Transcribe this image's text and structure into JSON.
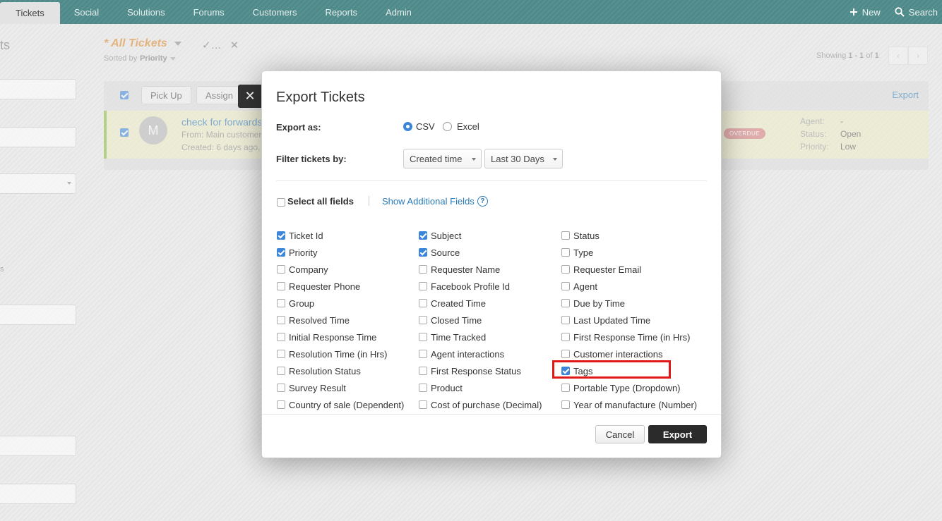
{
  "nav": {
    "tabs": [
      "Tickets",
      "Social",
      "Solutions",
      "Forums",
      "Customers",
      "Reports",
      "Admin"
    ],
    "new_label": "New",
    "search_label": "Search"
  },
  "background": {
    "side_label_top": "ts",
    "side_label_mid": "s",
    "view_title": "* All Tickets",
    "sorted_by_prefix": "Sorted by",
    "sorted_by_value": "Priority",
    "showing_prefix": "Showing",
    "showing_range": "1 - 1",
    "showing_of": "of",
    "showing_total": "1",
    "toolbar": {
      "pick_up": "Pick Up",
      "assign": "Assign",
      "export": "Export"
    },
    "ticket": {
      "avatar_letter": "M",
      "subject": "check for forwards",
      "from": "From: Main customer",
      "created": "Created: 6 days ago,",
      "badge": "OVERDUE",
      "meta": [
        {
          "k": "Agent:",
          "v": "-"
        },
        {
          "k": "Status:",
          "v": "Open"
        },
        {
          "k": "Priority:",
          "v": "Low"
        }
      ]
    }
  },
  "modal": {
    "title": "Export Tickets",
    "export_as_label": "Export as:",
    "formats": [
      {
        "label": "CSV",
        "selected": true
      },
      {
        "label": "Excel",
        "selected": false
      }
    ],
    "filter_label": "Filter tickets by:",
    "filter_field": "Created time",
    "filter_range": "Last 30 Days",
    "select_all_label": "Select all fields",
    "show_additional_label": "Show Additional Fields",
    "fields": [
      {
        "label": "Ticket Id",
        "checked": true
      },
      {
        "label": "Subject",
        "checked": true
      },
      {
        "label": "Status",
        "checked": false
      },
      {
        "label": "Priority",
        "checked": true
      },
      {
        "label": "Source",
        "checked": true
      },
      {
        "label": "Type",
        "checked": false
      },
      {
        "label": "Company",
        "checked": false
      },
      {
        "label": "Requester Name",
        "checked": false
      },
      {
        "label": "Requester Email",
        "checked": false
      },
      {
        "label": "Requester Phone",
        "checked": false
      },
      {
        "label": "Facebook Profile Id",
        "checked": false
      },
      {
        "label": "Agent",
        "checked": false
      },
      {
        "label": "Group",
        "checked": false
      },
      {
        "label": "Created Time",
        "checked": false
      },
      {
        "label": "Due by Time",
        "checked": false
      },
      {
        "label": "Resolved Time",
        "checked": false
      },
      {
        "label": "Closed Time",
        "checked": false
      },
      {
        "label": "Last Updated Time",
        "checked": false
      },
      {
        "label": "Initial Response Time",
        "checked": false
      },
      {
        "label": "Time Tracked",
        "checked": false
      },
      {
        "label": "First Response Time (in Hrs)",
        "checked": false
      },
      {
        "label": "Resolution Time (in Hrs)",
        "checked": false
      },
      {
        "label": "Agent interactions",
        "checked": false
      },
      {
        "label": "Customer interactions",
        "checked": false
      },
      {
        "label": "Resolution Status",
        "checked": false
      },
      {
        "label": "First Response Status",
        "checked": false
      },
      {
        "label": "Tags",
        "checked": true
      },
      {
        "label": "Survey Result",
        "checked": false
      },
      {
        "label": "Product",
        "checked": false
      },
      {
        "label": "Portable Type (Dropdown)",
        "checked": false
      },
      {
        "label": "Country of sale (Dependent)",
        "checked": false
      },
      {
        "label": "Cost of purchase (Decimal)",
        "checked": false
      },
      {
        "label": "Year of manufacture (Number)",
        "checked": false
      }
    ],
    "cancel_label": "Cancel",
    "export_label": "Export"
  },
  "colors": {
    "nav_bg": "#4f8a8a",
    "accent": "#3d85d8",
    "link": "#2a7ab7",
    "highlight": "#e01818",
    "primary_button": "#2b2b2b"
  }
}
